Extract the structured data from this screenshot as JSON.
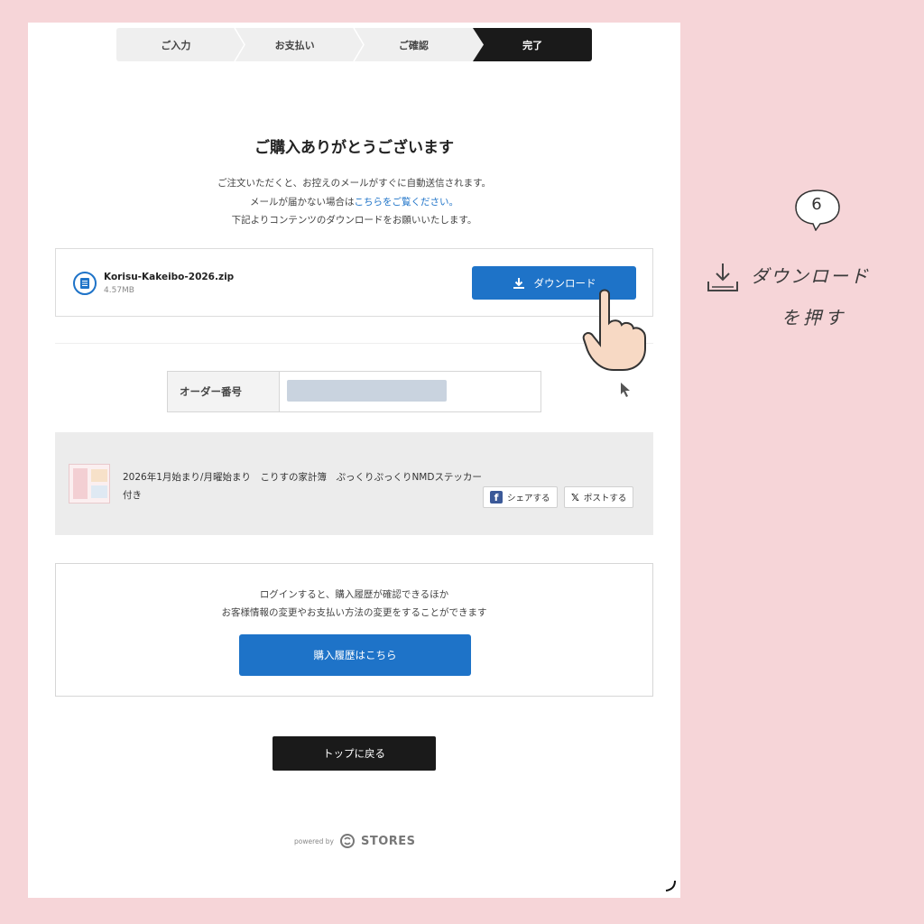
{
  "stepper": {
    "steps": [
      "ご入力",
      "お支払い",
      "ご確認",
      "完了"
    ],
    "active_index": 3
  },
  "thanks": {
    "title": "ご購入ありがとうございます",
    "line1": "ご注文いただくと、お控えのメールがすぐに自動送信されます。",
    "line2_prefix": "メールが届かない場合は",
    "line2_link": "こちらをご覧ください。",
    "line3": "下記よりコンテンツのダウンロードをお願いいたします。"
  },
  "download": {
    "file_name": "Korisu-Kakeibo-2026.zip",
    "file_size": "4.57MB",
    "button_label": "ダウンロード"
  },
  "order": {
    "label": "オーダー番号",
    "value": ""
  },
  "product": {
    "name": "2026年1月始まり/月曜始まり　こりすの家計簿　ぷっくりぷっくりNMDステッカー付き",
    "share_facebook": "シェアする",
    "share_x": "ポストする"
  },
  "login": {
    "line1": "ログインすると、購入履歴が確認できるほか",
    "line2": "お客様情報の変更やお支払い方法の変更をすることができます",
    "button_label": "購入履歴はこちら"
  },
  "top_button_label": "トップに戻る",
  "footer": {
    "powered_by": "powered by",
    "brand": "STORES"
  },
  "annotation": {
    "step_number": "6",
    "line1": "ダウンロード",
    "line2": "を押す"
  },
  "colors": {
    "accent": "#1e73c8",
    "background": "#f6d5d8",
    "dark": "#1a1a1a"
  }
}
